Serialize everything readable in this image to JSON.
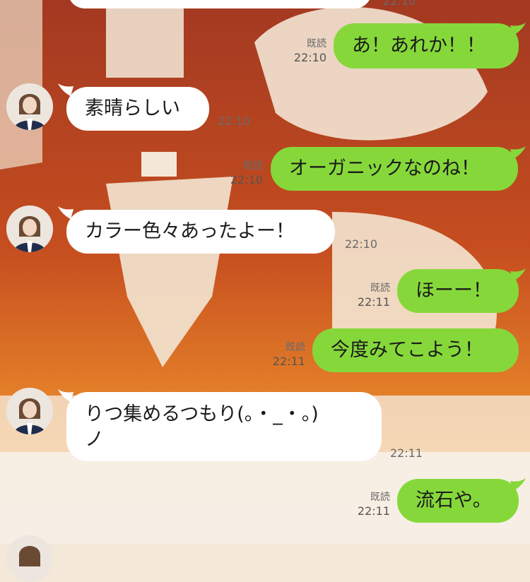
{
  "chat": {
    "top_partial": {
      "time": "22:10"
    },
    "messages": [
      {
        "id": "m1",
        "side": "out",
        "text": "あ！あれか！！",
        "read": "既読",
        "time": "22:10"
      },
      {
        "id": "m2",
        "side": "in",
        "text": "素晴らしい",
        "time": "22:10"
      },
      {
        "id": "m3",
        "side": "out",
        "text": "オーガニックなのね！",
        "read": "既読",
        "time": "22:10"
      },
      {
        "id": "m4",
        "side": "in",
        "text": "カラー色々あったよー！",
        "time": "22:10"
      },
      {
        "id": "m5",
        "side": "out",
        "text": "ほーー！",
        "read": "既読",
        "time": "22:11"
      },
      {
        "id": "m6",
        "side": "out",
        "text": "今度みてこよう！",
        "read": "既読",
        "time": "22:11"
      },
      {
        "id": "m7",
        "side": "in",
        "text_line1": "りつ集めるつもり(。・_・。)",
        "text_line2": "ノ",
        "time": "22:11"
      },
      {
        "id": "m8",
        "side": "out",
        "text": "流石や。",
        "read": "既読",
        "time": "22:11"
      }
    ]
  },
  "colors": {
    "outgoing_bubble": "#86d83a",
    "incoming_bubble": "#ffffff"
  }
}
